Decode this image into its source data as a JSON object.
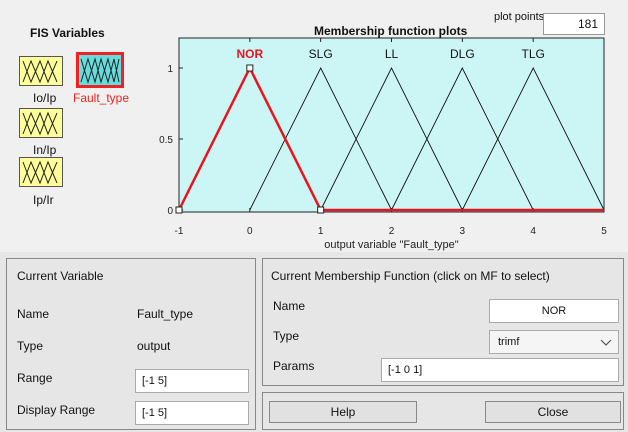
{
  "fis_panel": {
    "title": "FIS Variables",
    "inputs": [
      {
        "label": "Io/Ip"
      },
      {
        "label": "In/Ip"
      },
      {
        "label": "Ip/Ir"
      }
    ],
    "output": {
      "label": "Fault_type"
    }
  },
  "plot": {
    "title": "Membership function plots",
    "plot_points_label": "plot points:",
    "plot_points_value": "181",
    "xlabel": "output variable \"Fault_type\""
  },
  "chart_data": {
    "type": "line",
    "title": "Membership function plots",
    "xlabel": "output variable \"Fault_type\"",
    "xlim": [
      -1,
      5
    ],
    "ylim": [
      0,
      1
    ],
    "x_ticks": [
      "-1",
      "0",
      "1",
      "2",
      "3",
      "4",
      "5"
    ],
    "y_ticks": [
      "0",
      "0.5",
      "1"
    ],
    "series": [
      {
        "name": "NOR",
        "type": "trimf",
        "params": [
          -1,
          0,
          1
        ],
        "selected": true
      },
      {
        "name": "SLG",
        "type": "trimf",
        "params": [
          0,
          1,
          2
        ],
        "selected": false
      },
      {
        "name": "LL",
        "type": "trimf",
        "params": [
          1,
          2,
          3
        ],
        "selected": false
      },
      {
        "name": "DLG",
        "type": "trimf",
        "params": [
          2,
          3,
          4
        ],
        "selected": false
      },
      {
        "name": "TLG",
        "type": "trimf",
        "params": [
          3,
          4,
          5
        ],
        "selected": false
      }
    ],
    "colors": {
      "selected": "#e8141e",
      "normal": "#111111",
      "background": "#ccf5f5"
    }
  },
  "current_variable": {
    "title": "Current Variable",
    "name_label": "Name",
    "name_value": "Fault_type",
    "type_label": "Type",
    "type_value": "output",
    "range_label": "Range",
    "range_value": "[-1 5]",
    "display_range_label": "Display Range",
    "display_range_value": "[-1 5]"
  },
  "current_mf": {
    "title": "Current Membership Function (click on MF to select)",
    "name_label": "Name",
    "name_value": "NOR",
    "type_label": "Type",
    "type_value": "trimf",
    "params_label": "Params",
    "params_value": "[-1 0 1]"
  },
  "buttons": {
    "help": "Help",
    "close": "Close"
  }
}
